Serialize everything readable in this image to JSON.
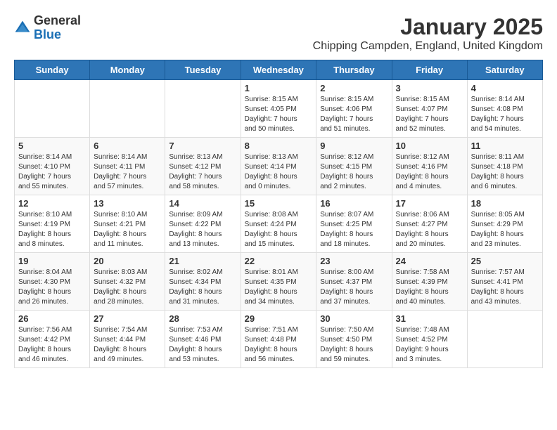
{
  "logo": {
    "general": "General",
    "blue": "Blue"
  },
  "title": "January 2025",
  "subtitle": "Chipping Campden, England, United Kingdom",
  "days_header": [
    "Sunday",
    "Monday",
    "Tuesday",
    "Wednesday",
    "Thursday",
    "Friday",
    "Saturday"
  ],
  "weeks": [
    [
      {
        "day": "",
        "info": ""
      },
      {
        "day": "",
        "info": ""
      },
      {
        "day": "",
        "info": ""
      },
      {
        "day": "1",
        "info": "Sunrise: 8:15 AM\nSunset: 4:05 PM\nDaylight: 7 hours\nand 50 minutes."
      },
      {
        "day": "2",
        "info": "Sunrise: 8:15 AM\nSunset: 4:06 PM\nDaylight: 7 hours\nand 51 minutes."
      },
      {
        "day": "3",
        "info": "Sunrise: 8:15 AM\nSunset: 4:07 PM\nDaylight: 7 hours\nand 52 minutes."
      },
      {
        "day": "4",
        "info": "Sunrise: 8:14 AM\nSunset: 4:08 PM\nDaylight: 7 hours\nand 54 minutes."
      }
    ],
    [
      {
        "day": "5",
        "info": "Sunrise: 8:14 AM\nSunset: 4:10 PM\nDaylight: 7 hours\nand 55 minutes."
      },
      {
        "day": "6",
        "info": "Sunrise: 8:14 AM\nSunset: 4:11 PM\nDaylight: 7 hours\nand 57 minutes."
      },
      {
        "day": "7",
        "info": "Sunrise: 8:13 AM\nSunset: 4:12 PM\nDaylight: 7 hours\nand 58 minutes."
      },
      {
        "day": "8",
        "info": "Sunrise: 8:13 AM\nSunset: 4:14 PM\nDaylight: 8 hours\nand 0 minutes."
      },
      {
        "day": "9",
        "info": "Sunrise: 8:12 AM\nSunset: 4:15 PM\nDaylight: 8 hours\nand 2 minutes."
      },
      {
        "day": "10",
        "info": "Sunrise: 8:12 AM\nSunset: 4:16 PM\nDaylight: 8 hours\nand 4 minutes."
      },
      {
        "day": "11",
        "info": "Sunrise: 8:11 AM\nSunset: 4:18 PM\nDaylight: 8 hours\nand 6 minutes."
      }
    ],
    [
      {
        "day": "12",
        "info": "Sunrise: 8:10 AM\nSunset: 4:19 PM\nDaylight: 8 hours\nand 8 minutes."
      },
      {
        "day": "13",
        "info": "Sunrise: 8:10 AM\nSunset: 4:21 PM\nDaylight: 8 hours\nand 11 minutes."
      },
      {
        "day": "14",
        "info": "Sunrise: 8:09 AM\nSunset: 4:22 PM\nDaylight: 8 hours\nand 13 minutes."
      },
      {
        "day": "15",
        "info": "Sunrise: 8:08 AM\nSunset: 4:24 PM\nDaylight: 8 hours\nand 15 minutes."
      },
      {
        "day": "16",
        "info": "Sunrise: 8:07 AM\nSunset: 4:25 PM\nDaylight: 8 hours\nand 18 minutes."
      },
      {
        "day": "17",
        "info": "Sunrise: 8:06 AM\nSunset: 4:27 PM\nDaylight: 8 hours\nand 20 minutes."
      },
      {
        "day": "18",
        "info": "Sunrise: 8:05 AM\nSunset: 4:29 PM\nDaylight: 8 hours\nand 23 minutes."
      }
    ],
    [
      {
        "day": "19",
        "info": "Sunrise: 8:04 AM\nSunset: 4:30 PM\nDaylight: 8 hours\nand 26 minutes."
      },
      {
        "day": "20",
        "info": "Sunrise: 8:03 AM\nSunset: 4:32 PM\nDaylight: 8 hours\nand 28 minutes."
      },
      {
        "day": "21",
        "info": "Sunrise: 8:02 AM\nSunset: 4:34 PM\nDaylight: 8 hours\nand 31 minutes."
      },
      {
        "day": "22",
        "info": "Sunrise: 8:01 AM\nSunset: 4:35 PM\nDaylight: 8 hours\nand 34 minutes."
      },
      {
        "day": "23",
        "info": "Sunrise: 8:00 AM\nSunset: 4:37 PM\nDaylight: 8 hours\nand 37 minutes."
      },
      {
        "day": "24",
        "info": "Sunrise: 7:58 AM\nSunset: 4:39 PM\nDaylight: 8 hours\nand 40 minutes."
      },
      {
        "day": "25",
        "info": "Sunrise: 7:57 AM\nSunset: 4:41 PM\nDaylight: 8 hours\nand 43 minutes."
      }
    ],
    [
      {
        "day": "26",
        "info": "Sunrise: 7:56 AM\nSunset: 4:42 PM\nDaylight: 8 hours\nand 46 minutes."
      },
      {
        "day": "27",
        "info": "Sunrise: 7:54 AM\nSunset: 4:44 PM\nDaylight: 8 hours\nand 49 minutes."
      },
      {
        "day": "28",
        "info": "Sunrise: 7:53 AM\nSunset: 4:46 PM\nDaylight: 8 hours\nand 53 minutes."
      },
      {
        "day": "29",
        "info": "Sunrise: 7:51 AM\nSunset: 4:48 PM\nDaylight: 8 hours\nand 56 minutes."
      },
      {
        "day": "30",
        "info": "Sunrise: 7:50 AM\nSunset: 4:50 PM\nDaylight: 8 hours\nand 59 minutes."
      },
      {
        "day": "31",
        "info": "Sunrise: 7:48 AM\nSunset: 4:52 PM\nDaylight: 9 hours\nand 3 minutes."
      },
      {
        "day": "",
        "info": ""
      }
    ]
  ]
}
